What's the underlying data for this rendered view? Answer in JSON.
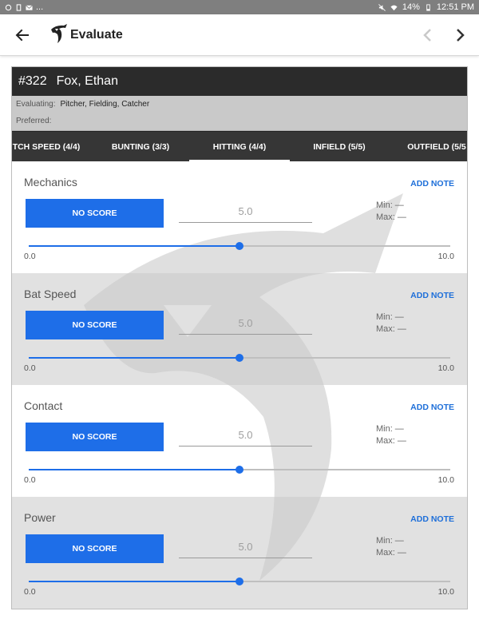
{
  "status_bar": {
    "left_icons": [
      "sync-icon",
      "battery-saver-icon",
      "mail-icon"
    ],
    "more": "...",
    "battery": "14%",
    "time": "12:51 PM"
  },
  "app_bar": {
    "title": "Evaluate"
  },
  "player": {
    "number": "#322",
    "name": "Fox, Ethan",
    "evaluating_label": "Evaluating:",
    "evaluating_value": "Pitcher, Fielding, Catcher",
    "preferred_label": "Preferred:",
    "preferred_value": ""
  },
  "tabs": [
    {
      "label": "TCH SPEED (4/4)",
      "active": false
    },
    {
      "label": "BUNTING (3/3)",
      "active": false
    },
    {
      "label": "HITTING (4/4)",
      "active": true
    },
    {
      "label": "INFIELD (5/5)",
      "active": false
    },
    {
      "label": "OUTFIELD (5/5",
      "active": false
    }
  ],
  "sections": [
    {
      "title": "Mechanics",
      "add_note": "ADD NOTE",
      "score_button": "NO SCORE",
      "score_value": "5.0",
      "min_label": "Min:",
      "min_value": "—",
      "max_label": "Max:",
      "max_value": "—",
      "range_min": "0.0",
      "range_max": "10.0",
      "slider_fraction": 0.5,
      "shaded": false
    },
    {
      "title": "Bat Speed",
      "add_note": "ADD NOTE",
      "score_button": "NO SCORE",
      "score_value": "5.0",
      "min_label": "Min:",
      "min_value": "—",
      "max_label": "Max:",
      "max_value": "—",
      "range_min": "0.0",
      "range_max": "10.0",
      "slider_fraction": 0.5,
      "shaded": true
    },
    {
      "title": "Contact",
      "add_note": "ADD NOTE",
      "score_button": "NO SCORE",
      "score_value": "5.0",
      "min_label": "Min:",
      "min_value": "—",
      "max_label": "Max:",
      "max_value": "—",
      "range_min": "0.0",
      "range_max": "10.0",
      "slider_fraction": 0.5,
      "shaded": false
    },
    {
      "title": "Power",
      "add_note": "ADD NOTE",
      "score_button": "NO SCORE",
      "score_value": "5.0",
      "min_label": "Min:",
      "min_value": "—",
      "max_label": "Max:",
      "max_value": "—",
      "range_min": "0.0",
      "range_max": "10.0",
      "slider_fraction": 0.5,
      "shaded": true
    }
  ],
  "colors": {
    "accent": "#1e6ee8",
    "link": "#1e6fd9",
    "header_bg": "#2b2b2b",
    "tabs_bg": "#363636",
    "status_bar_bg": "#7f7f7f"
  }
}
